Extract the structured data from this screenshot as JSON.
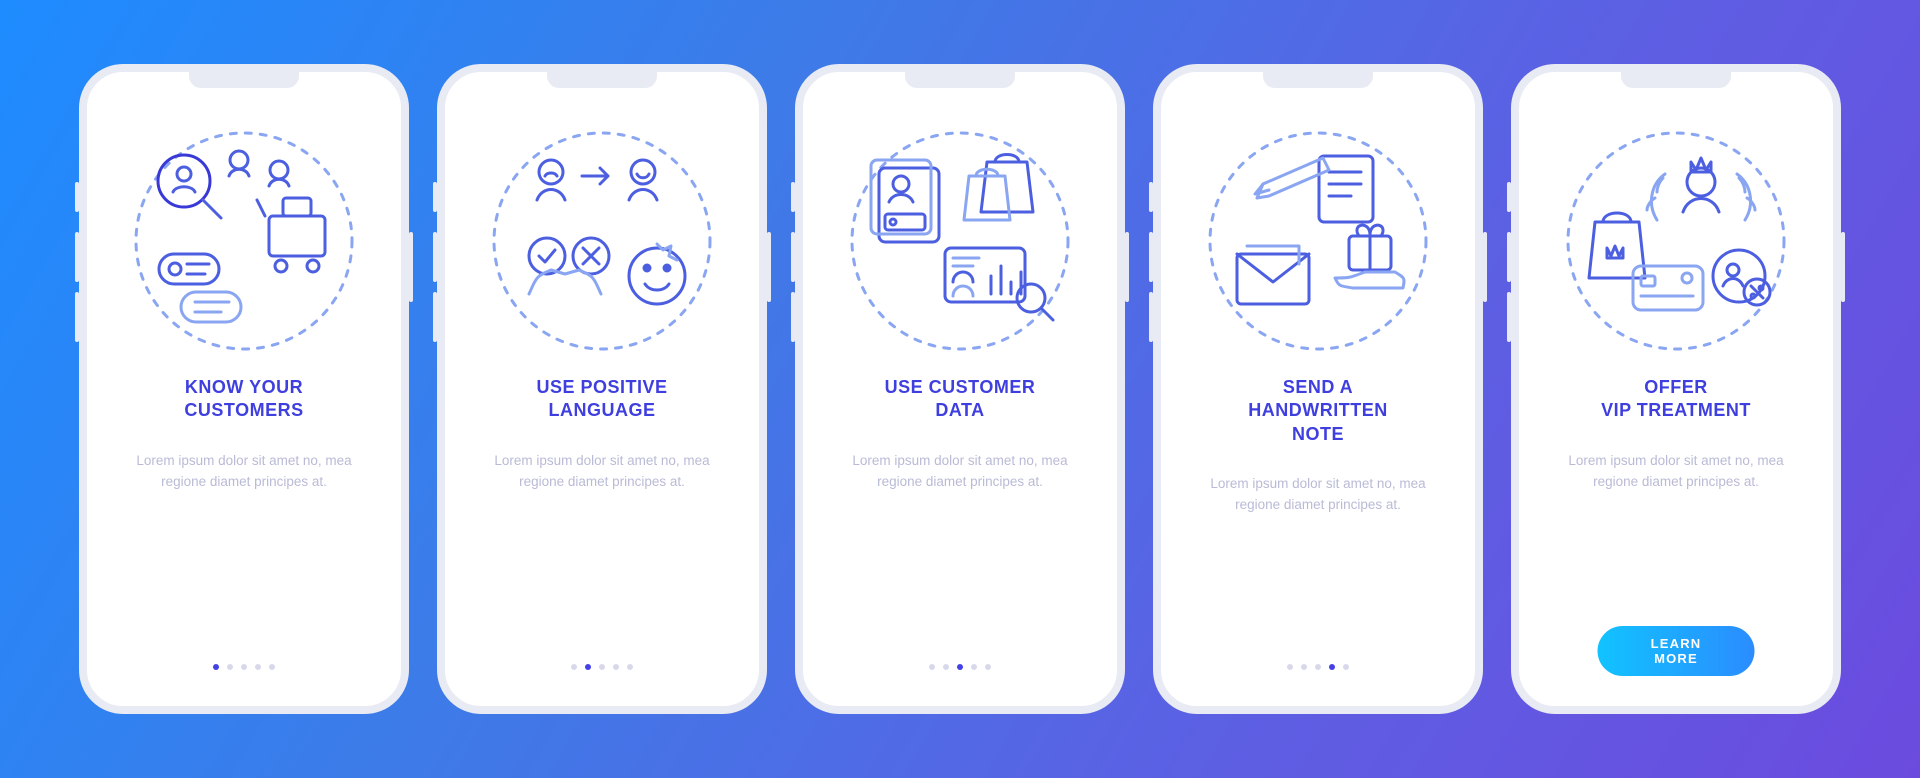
{
  "body_text": "Lorem ipsum dolor sit amet no, mea regione diamet principes at.",
  "cta_label": "LEARN MORE",
  "screens": [
    {
      "title": "KNOW YOUR\nCUSTOMERS",
      "active_dot": 0,
      "icon": "know-customers-icon"
    },
    {
      "title": "USE POSITIVE\nLANGUAGE",
      "active_dot": 1,
      "icon": "positive-language-icon"
    },
    {
      "title": "USE CUSTOMER\nDATA",
      "active_dot": 2,
      "icon": "customer-data-icon"
    },
    {
      "title": "SEND A\nHANDWRITTEN\nNOTE",
      "active_dot": 3,
      "icon": "handwritten-note-icon"
    },
    {
      "title": "OFFER\nVIP TREATMENT",
      "active_dot": 4,
      "icon": "vip-treatment-icon"
    }
  ],
  "colors": {
    "stroke_dark": "#3839d6",
    "stroke_light": "#7ea0f0"
  }
}
